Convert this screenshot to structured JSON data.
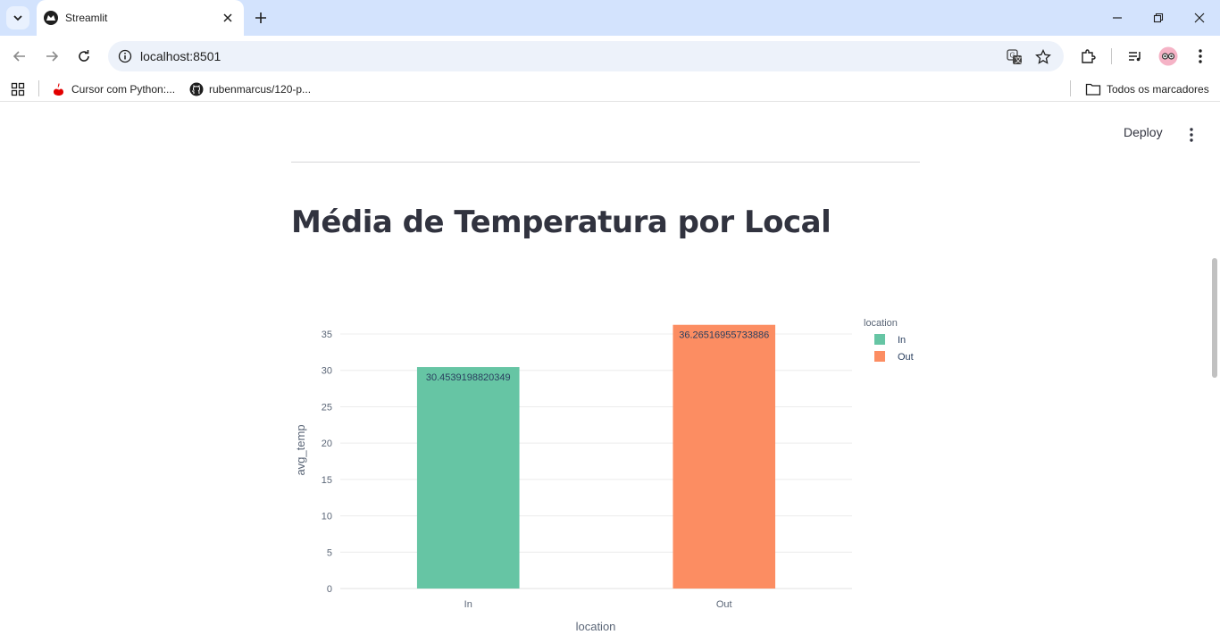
{
  "browser": {
    "tab_title": "Streamlit",
    "url": "localhost:8501",
    "bookmarks": [
      {
        "label": "Cursor com Python:...",
        "icon": "santander-icon"
      },
      {
        "label": "rubenmarcus/120-p...",
        "icon": "github-icon"
      }
    ],
    "all_bookmarks_label": "Todos os marcadores"
  },
  "app": {
    "deploy_label": "Deploy",
    "heading": "Média de Temperatura por Local"
  },
  "chart_data": {
    "type": "bar",
    "categories": [
      "In",
      "Out"
    ],
    "values": [
      30.4539198820349,
      36.26516955733886
    ],
    "data_labels": [
      "30.4539198820349",
      "36.26516955733886"
    ],
    "colors": [
      "#66c5a4",
      "#fc8d62"
    ],
    "xlabel": "location",
    "ylabel": "avg_temp",
    "ylim": [
      0,
      36.6
    ],
    "yticks": [
      0,
      5,
      10,
      15,
      20,
      25,
      30,
      35
    ],
    "grid": true,
    "legend": {
      "title": "location",
      "entries": [
        {
          "name": "In",
          "color": "#66c5a4"
        },
        {
          "name": "Out",
          "color": "#fc8d62"
        }
      ],
      "placement": "top-right"
    }
  }
}
